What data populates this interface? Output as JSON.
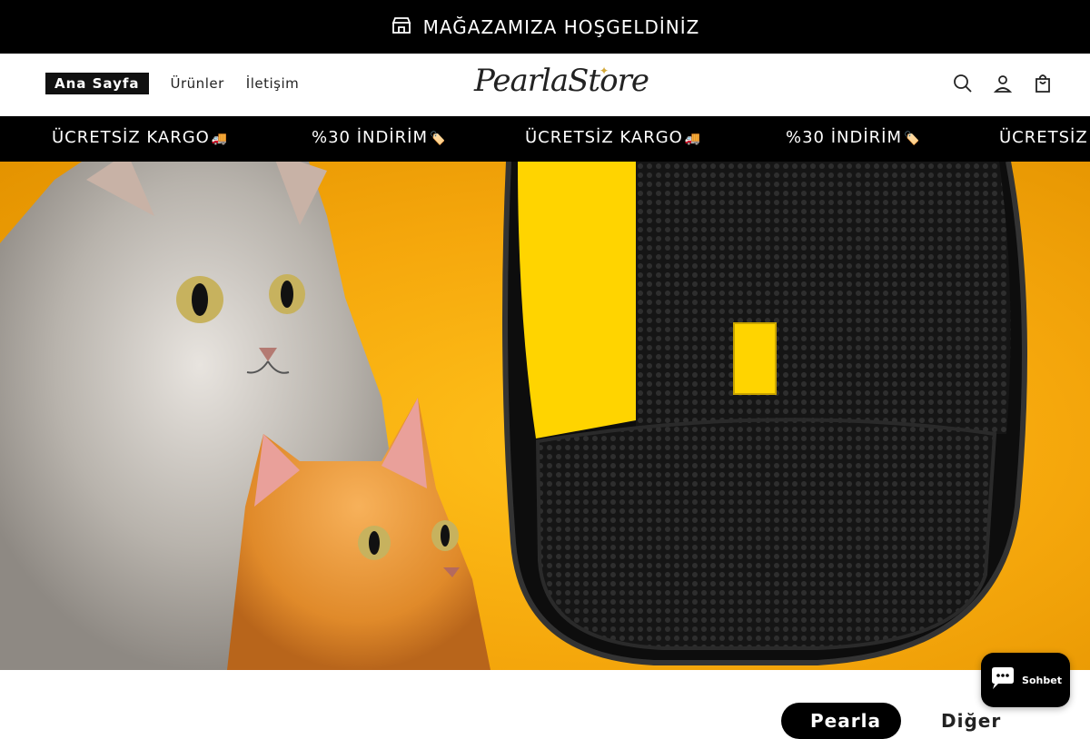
{
  "announcement": {
    "text": "MAĞAZAMIZA HOŞGELDİNİZ",
    "icon": "store-icon"
  },
  "nav": {
    "items": [
      {
        "label": "Ana Sayfa",
        "active": true
      },
      {
        "label": "Ürünler",
        "active": false
      },
      {
        "label": "İletişim",
        "active": false
      }
    ]
  },
  "logo": {
    "text": "PearlaStore"
  },
  "header_icons": [
    "search-icon",
    "account-icon",
    "cart-icon"
  ],
  "marquee": {
    "items": [
      {
        "text": "ÜCRETSİZ KARGO",
        "emoji": "🚚"
      },
      {
        "text": "%30 İNDİRİM",
        "emoji": "🏷️"
      },
      {
        "text": "ÜCRETSİZ KARGO",
        "emoji": "🚚"
      },
      {
        "text": "%30 İNDİRİM",
        "emoji": "🏷️"
      },
      {
        "text": "ÜCRETSİZ K",
        "emoji": ""
      }
    ]
  },
  "tabs": [
    {
      "label": "Pearla",
      "active": true
    },
    {
      "label": "Diğer",
      "active": false
    }
  ],
  "chat": {
    "label": "Sohbet"
  },
  "colors": {
    "hero_bg": "#f7ae12",
    "glove_yellow": "#ffd400",
    "black": "#000000"
  }
}
